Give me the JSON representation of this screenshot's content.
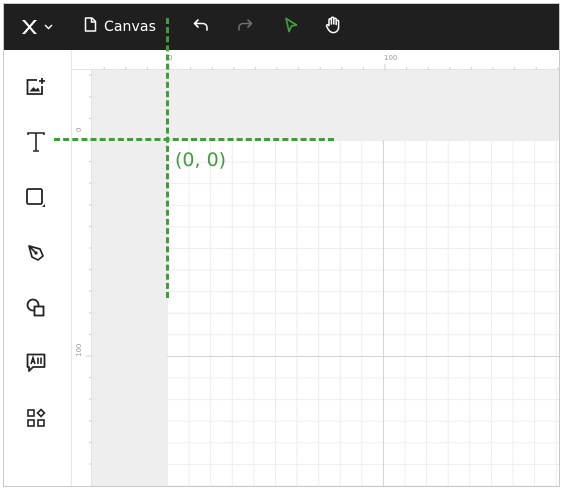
{
  "toolbar": {
    "document_name": "Canvas",
    "logo_icon": "x-logo-icon",
    "logo_menu_icon": "chevron-down-icon",
    "document_icon": "file-icon",
    "undo_icon": "undo-icon",
    "redo_icon": "redo-icon",
    "select_icon": "pointer-icon",
    "hand_icon": "hand-icon",
    "select_active_color": "#3f9e3a"
  },
  "left_tools": [
    {
      "name": "add-image",
      "icon": "image-plus-icon"
    },
    {
      "name": "text",
      "icon": "text-t-icon"
    },
    {
      "name": "rectangle",
      "icon": "square-icon"
    },
    {
      "name": "pen",
      "icon": "pen-icon"
    },
    {
      "name": "shapes",
      "icon": "shapes-icon"
    },
    {
      "name": "ai",
      "icon": "ai-chat-icon"
    },
    {
      "name": "apps",
      "icon": "apps-icon"
    }
  ],
  "rulers": {
    "top_labels": [
      "0",
      "100"
    ],
    "left_labels": [
      "0",
      "100"
    ]
  },
  "annotation": {
    "origin_label": "(0, 0)",
    "color": "#3f9e3a"
  }
}
